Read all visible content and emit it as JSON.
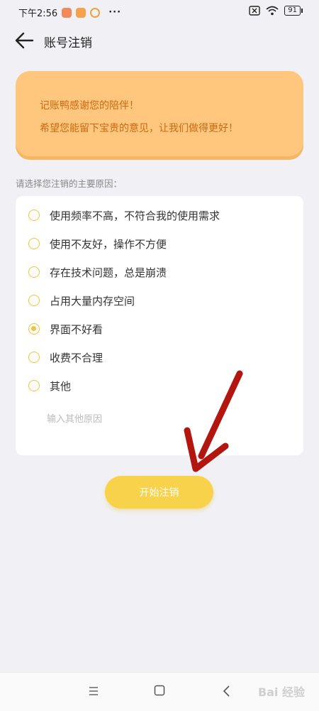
{
  "status_bar": {
    "time": "下午2:56",
    "more": "···",
    "battery": "91"
  },
  "header": {
    "title": "账号注销"
  },
  "banner": {
    "line1": "记账鸭感谢您的陪伴！",
    "line2": "希望您能留下宝贵的意见，让我们做得更好！"
  },
  "form": {
    "section_label": "请选择您注销的主要原因：",
    "options": [
      {
        "label": "使用频率不高，不符合我的使用需求",
        "checked": false
      },
      {
        "label": "使用不友好，操作不方便",
        "checked": false
      },
      {
        "label": "存在技术问题，总是崩溃",
        "checked": false
      },
      {
        "label": "占用大量内存空间",
        "checked": false
      },
      {
        "label": "界面不好看",
        "checked": true
      },
      {
        "label": "收费不合理",
        "checked": false
      },
      {
        "label": "其他",
        "checked": false
      }
    ],
    "other_placeholder": "输入其他原因",
    "other_value": ""
  },
  "actions": {
    "submit_label": "开始注销"
  },
  "colors": {
    "accent": "#f8d24a",
    "banner_bg": "#ffc77e",
    "banner_text": "#c96a12",
    "radio": "#f4c23c",
    "annotation_arrow": "#b3160f"
  },
  "watermark": "Bai 经验"
}
